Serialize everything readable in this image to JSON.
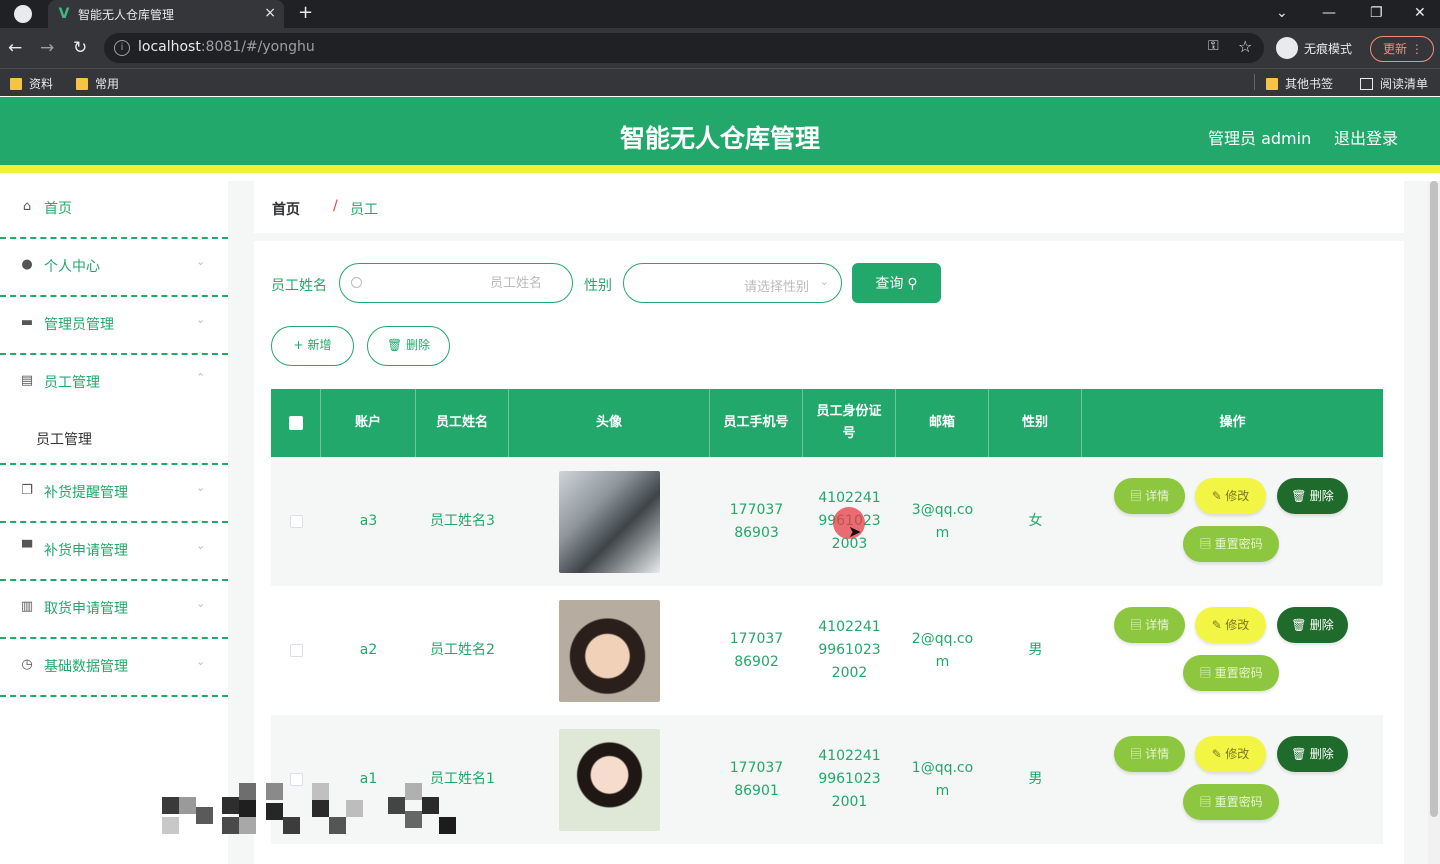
{
  "browser": {
    "tab_title": "智能无人仓库管理",
    "tab_close": "×",
    "new_tab": "+",
    "url_host": "localhost",
    "url_rest": ":8081/#/yonghu",
    "incognito_label": "无痕模式",
    "update_label": "更新",
    "bookmarks": [
      "资料",
      "常用",
      "其他书签",
      "阅读清单"
    ]
  },
  "header": {
    "title": "智能无人仓库管理",
    "user_label": "管理员 admin",
    "logout_label": "退出登录",
    "colors": {
      "primary": "#22a86b",
      "accent_bar": "#f0f23a"
    }
  },
  "sidebar": {
    "items": [
      {
        "label": "首页",
        "icon": "home-icon"
      },
      {
        "label": "个人中心",
        "icon": "user-icon"
      },
      {
        "label": "管理员管理",
        "icon": "briefcase-icon"
      },
      {
        "label": "员工管理",
        "icon": "clipboard-icon"
      },
      {
        "label": "补货提醒管理",
        "icon": "copy-icon"
      },
      {
        "label": "补货申请管理",
        "icon": "monitor-icon"
      },
      {
        "label": "取货申请管理",
        "icon": "chart-icon"
      },
      {
        "label": "基础数据管理",
        "icon": "clock-icon"
      }
    ],
    "sub_item": "员工管理"
  },
  "breadcrumb": {
    "home": "首页",
    "separator": "/",
    "current": "员工"
  },
  "search": {
    "name_label": "员工姓名",
    "name_placeholder": "员工姓名",
    "gender_label": "性别",
    "gender_placeholder": "请选择性别",
    "query_label": "查询"
  },
  "actions": {
    "add_label": "新增",
    "delete_label": "删除"
  },
  "table": {
    "headers": [
      "账户",
      "员工姓名",
      "头像",
      "员工手机号",
      "员工身份证号",
      "邮箱",
      "性别",
      "操作"
    ],
    "rows": [
      {
        "account": "a3",
        "name": "员工姓名3",
        "avatar": "husky-photo",
        "phone": "17703786903",
        "id_card": "410224199610232003",
        "email": "3@qq.com",
        "gender": "女"
      },
      {
        "account": "a2",
        "name": "员工姓名2",
        "avatar": "boy-photo",
        "phone": "17703786902",
        "id_card": "410224199610232002",
        "email": "2@qq.com",
        "gender": "男"
      },
      {
        "account": "a1",
        "name": "员工姓名1",
        "avatar": "girl-photo",
        "phone": "17703786901",
        "id_card": "410224199610232001",
        "email": "1@qq.com",
        "gender": "男"
      }
    ],
    "row_buttons": {
      "detail": "详情",
      "edit": "修改",
      "delete": "删除",
      "reset": "重置密码"
    }
  }
}
